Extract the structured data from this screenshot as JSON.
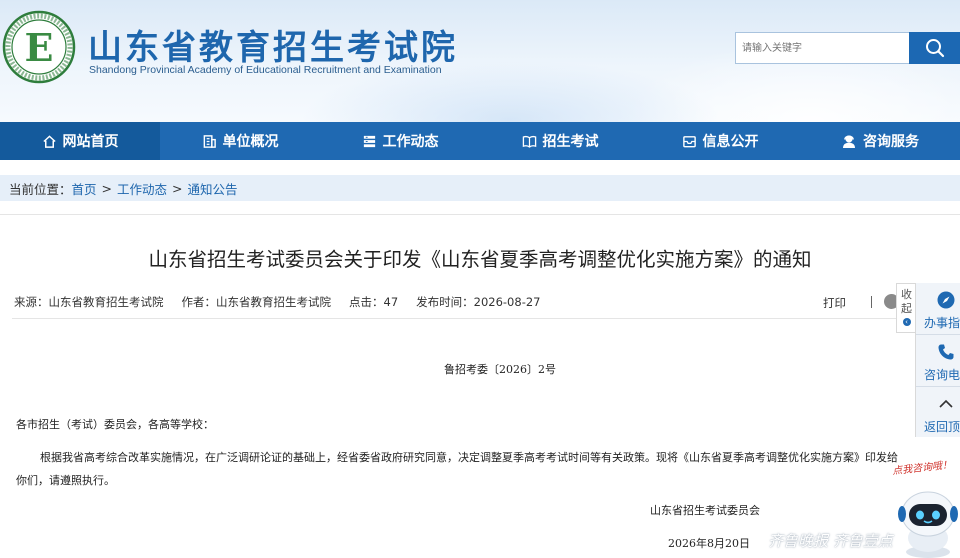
{
  "header": {
    "title": "山东省教育招生考试院",
    "subtitle": "Shandong Provincial Academy of Educational Recruitment and Examination",
    "logo_letter": "E"
  },
  "search": {
    "placeholder": "请输入关键字",
    "icon": "search-icon"
  },
  "nav": {
    "items": [
      {
        "label": "网站首页",
        "icon": "home-icon"
      },
      {
        "label": "单位概况",
        "icon": "building-icon"
      },
      {
        "label": "工作动态",
        "icon": "list-icon"
      },
      {
        "label": "招生考试",
        "icon": "book-icon"
      },
      {
        "label": "信息公开",
        "icon": "inbox-icon"
      },
      {
        "label": "咨询服务",
        "icon": "user-service-icon"
      }
    ]
  },
  "breadcrumb": {
    "label": "当前位置：",
    "items": [
      "首页",
      "工作动态",
      "通知公告"
    ],
    "separator": ">"
  },
  "article": {
    "title": "山东省招生考试委员会关于印发《山东省夏季高考调整优化实施方案》的通知",
    "meta": {
      "source": "来源：山东省教育招生考试院",
      "author": "作者：山东省教育招生考试院",
      "clicks": "点击：47",
      "publish_time": "发布时间：2026-08-27"
    },
    "print_label": "打印",
    "doc_number": "鲁招考委〔2026〕2号",
    "salutation": "各市招生（考试）委员会，各高等学校：",
    "body": "根据我省高考综合改革实施情况，在广泛调研论证的基础上，经省委省政府研究同意，决定调整夏季高考考试时间等有关政策。现将《山东省夏季高考调整优化实施方案》印发给你们，请遵照执行。",
    "signer": "山东省招生考试委员会",
    "date": "2026年8月20日"
  },
  "side_panel": {
    "collapse_label": "收起",
    "items": [
      {
        "label": "办事指",
        "icon": "compass-icon"
      },
      {
        "label": "咨询电",
        "icon": "phone-icon"
      },
      {
        "label": "返回顶",
        "icon": "chevron-up-icon"
      }
    ]
  },
  "mascot": {
    "bubble_text": "点我咨询哦！"
  },
  "watermark": "齐鲁晚报 齐鲁壹点",
  "colors": {
    "primary": "#1f69b2",
    "nav_active": "#145a9c",
    "breadcrumb_bg": "#e6eff9",
    "title_blue": "#1e66ad"
  }
}
